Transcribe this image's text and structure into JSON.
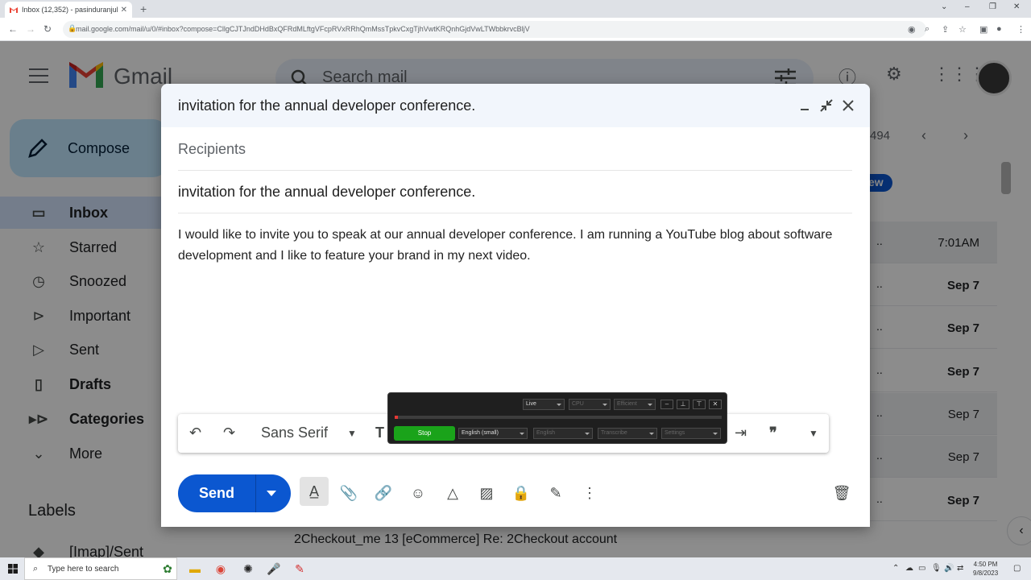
{
  "browser": {
    "tab_title": "Inbox (12,352) - pasinduranjula@...",
    "new_tab": "+",
    "url": "mail.google.com/mail/u/0/#inbox?compose=CllgCJTJndDHdBxQFRdMLftgVFcpRVxRRhQmMssTpkvCxgTjhVwtKRQnhGjdVwLTWbbkrvcBljV"
  },
  "gmail": {
    "logo_text": "Gmail",
    "search_placeholder": "Search mail",
    "compose_label": "Compose",
    "nav": [
      {
        "label": "Inbox",
        "icon": "inbox-icon"
      },
      {
        "label": "Starred",
        "icon": "star-icon"
      },
      {
        "label": "Snoozed",
        "icon": "clock-icon"
      },
      {
        "label": "Important",
        "icon": "important-icon"
      },
      {
        "label": "Sent",
        "icon": "send-icon"
      },
      {
        "label": "Drafts",
        "icon": "draft-icon"
      },
      {
        "label": "Categories",
        "icon": "label-icon"
      },
      {
        "label": "More",
        "icon": "chevron-down-icon"
      }
    ],
    "labels_heading": "Labels",
    "label_items": [
      "[Imap]/Sent"
    ],
    "count_fragment": "494",
    "new_badge": "ew",
    "email_rows": [
      {
        "date": "7:01AM",
        "unread": false
      },
      {
        "date": "Sep 7",
        "unread": true
      },
      {
        "date": "Sep 7",
        "unread": true
      },
      {
        "date": "Sep 7",
        "unread": true
      },
      {
        "date": "Sep 7",
        "unread": false
      },
      {
        "date": "Sep 7",
        "unread": false
      },
      {
        "date": "Sep 7",
        "unread": true
      }
    ],
    "bottom_row_text": "2Checkout_me 13        [eCommerce] Re: 2Checkout account"
  },
  "compose": {
    "title": "invitation for the annual developer conference.",
    "recipients_placeholder": "Recipients",
    "subject": "invitation for the annual developer conference.",
    "body": "I would like to invite you to speak at our annual developer conference. I am running a YouTube blog about software development and I like to feature your brand in my next video.",
    "font": "Sans Serif",
    "send_label": "Send"
  },
  "recorder": {
    "mode": "Live",
    "device": "CPU",
    "quality": "Efficient",
    "stop_label": "Stop",
    "model": "English (small)",
    "language": "English",
    "task": "Transcribe",
    "settings": "Settings",
    "progress": 0.01
  },
  "taskbar": {
    "search_placeholder": "Type here to search",
    "time": "4:50 PM",
    "date": "9/8/2023"
  }
}
